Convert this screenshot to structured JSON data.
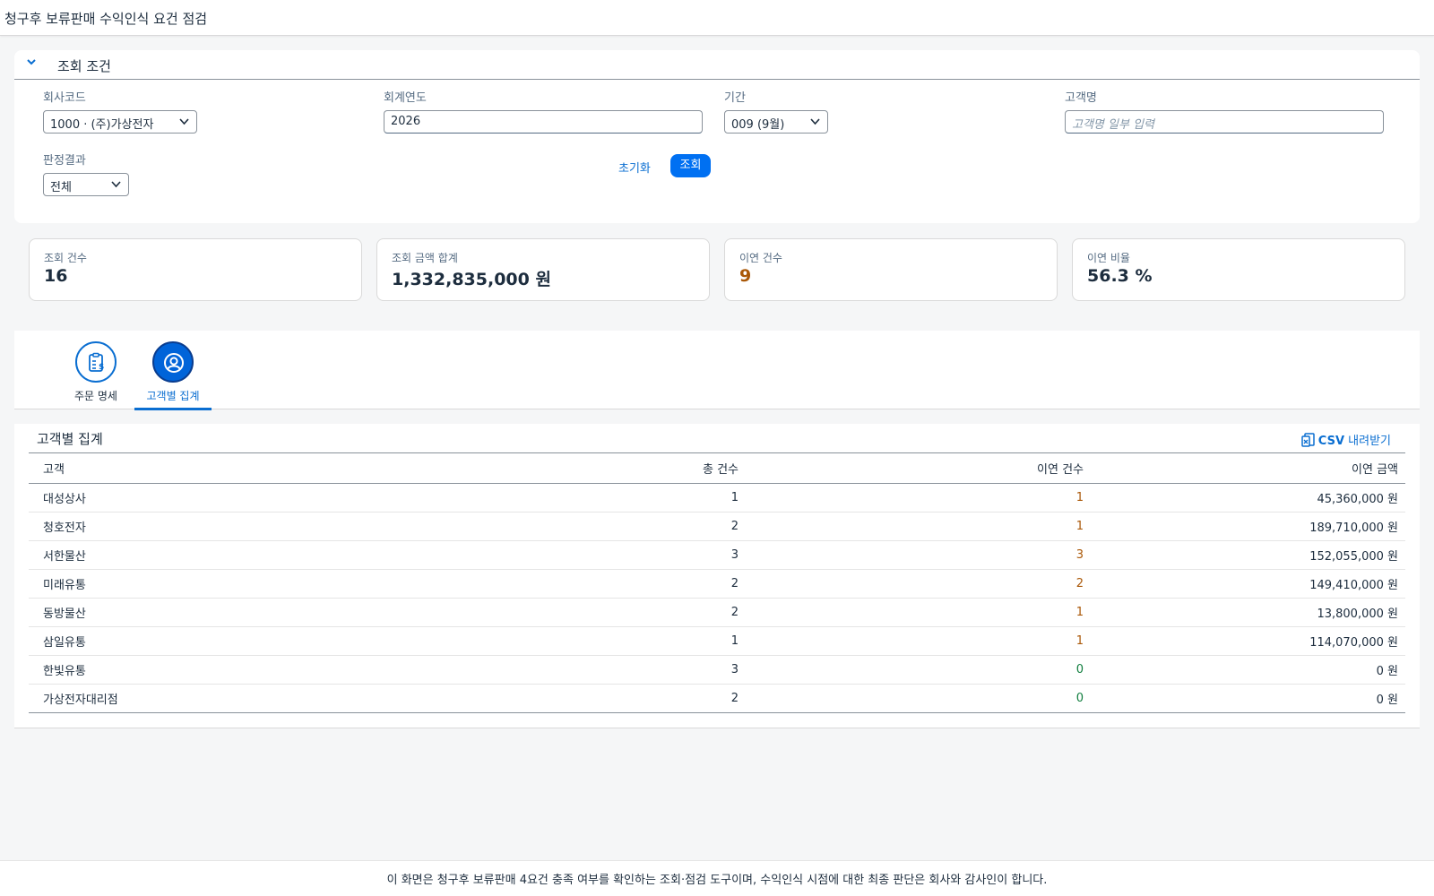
{
  "app": {
    "title": "청구후 보류판매 수익인식 요건 점검"
  },
  "filter": {
    "section_title": "조회 조건",
    "company": {
      "label": "회사코드",
      "value": "1000 · (주)가상전자"
    },
    "year": {
      "label": "회계연도",
      "value": "2026"
    },
    "period": {
      "label": "기간",
      "value": "009 (9월)"
    },
    "customer": {
      "label": "고객명",
      "placeholder": "고객명 일부 입력"
    },
    "result": {
      "label": "판정결과",
      "value": "전체"
    },
    "reset_label": "초기화",
    "search_label": "조회"
  },
  "kpis": [
    {
      "label": "조회 건수",
      "value": "16"
    },
    {
      "label": "조회 금액 합계",
      "value": "1,332,835,000 원"
    },
    {
      "label": "이연 건수",
      "value": "9"
    },
    {
      "label": "이연 비율",
      "value": "56.3 %"
    }
  ],
  "tabs": [
    {
      "label": "주문 명세",
      "icon": "order-clipboard-icon"
    },
    {
      "label": "고객별 집계",
      "icon": "customer-icon"
    }
  ],
  "table": {
    "title": "고객별 집계",
    "csv_strong": "CSV",
    "csv_rest": " 내려받기",
    "columns": [
      "고객",
      "총 건수",
      "이연 건수",
      "이연 금액"
    ],
    "rows": [
      {
        "customer": "대성상사",
        "total": "1",
        "deferred": "1",
        "amount": "45,360,000 원"
      },
      {
        "customer": "청호전자",
        "total": "2",
        "deferred": "1",
        "amount": "189,710,000 원"
      },
      {
        "customer": "서한물산",
        "total": "3",
        "deferred": "3",
        "amount": "152,055,000 원"
      },
      {
        "customer": "미래유통",
        "total": "2",
        "deferred": "2",
        "amount": "149,410,000 원"
      },
      {
        "customer": "동방물산",
        "total": "2",
        "deferred": "1",
        "amount": "13,800,000 원"
      },
      {
        "customer": "삼일유통",
        "total": "1",
        "deferred": "1",
        "amount": "114,070,000 원"
      },
      {
        "customer": "한빛유통",
        "total": "3",
        "deferred": "0",
        "amount": "0 원"
      },
      {
        "customer": "가상전자대리점",
        "total": "2",
        "deferred": "0",
        "amount": "0 원"
      }
    ]
  },
  "footer": {
    "text": "이 화면은 청구후 보류판매 4요건 충족 여부를 확인하는 조회·점검 도구이며, 수익인식 시점에 대한 최종 판단은 회사와 감사인이 합니다."
  },
  "colors": {
    "accent": "#0a6ed1",
    "primary_button": "#0070f2",
    "warning": "#aa5808",
    "positive": "#107e3e"
  }
}
